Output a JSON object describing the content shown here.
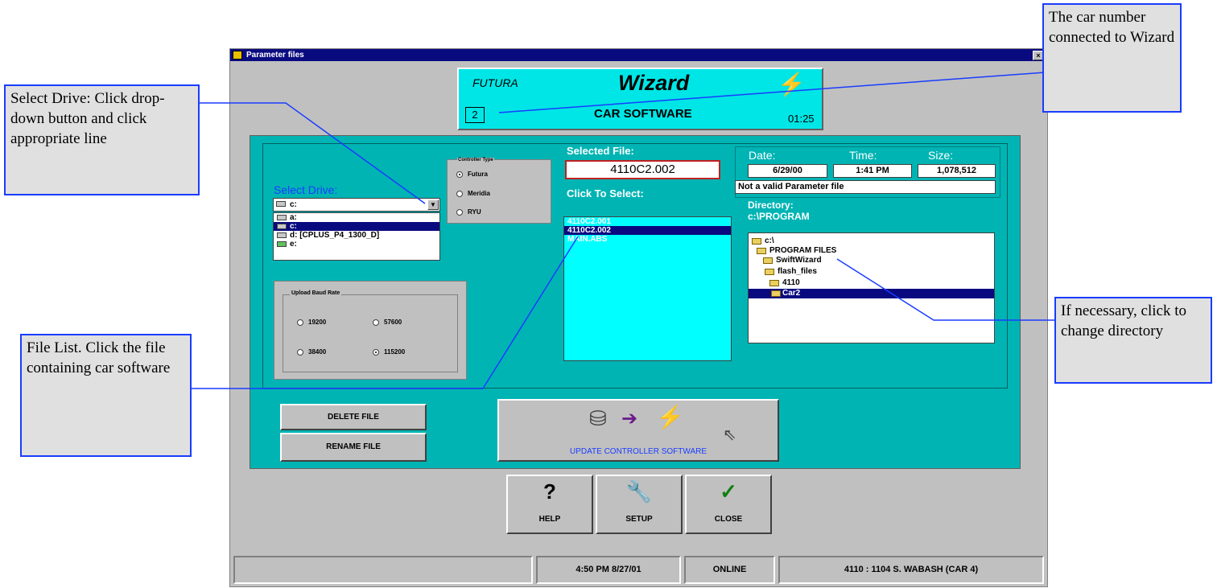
{
  "window": {
    "title": "Parameter files",
    "close_glyph": "×"
  },
  "header": {
    "brand": "FUTURA",
    "product": "Wizard",
    "subtitle": "CAR SOFTWARE",
    "car_number": "2",
    "clock": "01:25"
  },
  "select_drive": {
    "label": "Select Drive:",
    "current": "c:",
    "options": [
      "a:",
      "c:",
      "d: [CPLUS_P4_1300_D]",
      "e:"
    ],
    "selected_index": 1
  },
  "controller_type": {
    "title": "Controller Type",
    "options": [
      "Futura",
      "Meridia",
      "RYU"
    ],
    "selected": "Futura"
  },
  "baud": {
    "title": "Upload Baud Rate",
    "options": [
      "19200",
      "57600",
      "38400",
      "115200"
    ],
    "selected": "115200"
  },
  "selected_file": {
    "label": "Selected File:",
    "value": "4110C2.002",
    "click_label": "Click To Select:"
  },
  "files": {
    "items": [
      "4110C2.001",
      "4110C2.002",
      "MAIN.ABS"
    ],
    "selected_index": 1
  },
  "file_info": {
    "date_label": "Date:",
    "time_label": "Time:",
    "size_label": "Size:",
    "date": "6/29/00",
    "time": "1:41 PM",
    "size": "1,078,512",
    "status": "Not a valid Parameter file"
  },
  "directory": {
    "label": "Directory:",
    "path": "c:\\PROGRAM",
    "tree": [
      "c:\\",
      "PROGRAM FILES",
      "SwiftWizard",
      "flash_files",
      "4110",
      "Car2"
    ],
    "selected_index": 5
  },
  "buttons": {
    "delete": "DELETE FILE",
    "rename": "RENAME FILE",
    "update": "UPDATE CONTROLLER SOFTWARE",
    "help": "HELP",
    "setup": "SETUP",
    "close": "CLOSE",
    "help_glyph": "?",
    "close_glyph": "✓",
    "update_arrow": "➔"
  },
  "status_bar": {
    "empty": "",
    "datetime": "4:50 PM 8/27/01",
    "connection": "ONLINE",
    "location": "4110 : 1104 S. WABASH (CAR 4)"
  },
  "annotations": {
    "drive": "Select Drive: Click drop-down button and click appropriate  line",
    "car": "The car number connected to Wizard",
    "file": "File List. Click the file containing car software",
    "directory": "If necessary, click to change directory"
  },
  "colors": {
    "teal": "#00b4b4",
    "cyan": "#00e6e6",
    "titlebar": "#0a0a80",
    "annotation_border": "#1a3cff",
    "selected_file_border": "#c02020"
  }
}
